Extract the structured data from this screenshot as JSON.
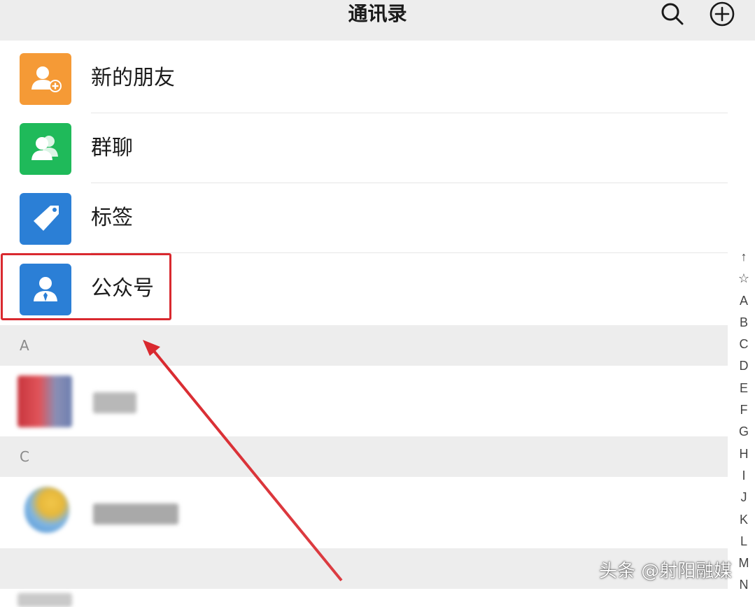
{
  "header": {
    "title": "通讯录",
    "search_icon": "search-icon",
    "add_icon": "add-circle-icon"
  },
  "entries": [
    {
      "label": "新的朋友",
      "icon": "add-friend-icon",
      "color": "#f59a36"
    },
    {
      "label": "群聊",
      "icon": "group-icon",
      "color": "#1fba5a"
    },
    {
      "label": "标签",
      "icon": "tag-icon",
      "color": "#2b7fd6"
    },
    {
      "label": "公众号",
      "icon": "official-account-icon",
      "color": "#2b7fd6"
    }
  ],
  "sections": [
    {
      "letter": "A"
    },
    {
      "letter": "C"
    }
  ],
  "index_bar": [
    "↑",
    "☆",
    "A",
    "B",
    "C",
    "D",
    "E",
    "F",
    "G",
    "H",
    "I",
    "J",
    "K",
    "L",
    "M",
    "N"
  ],
  "annotation": {
    "highlight_color": "#d9292f"
  },
  "watermark": "头条 @射阳融媒"
}
